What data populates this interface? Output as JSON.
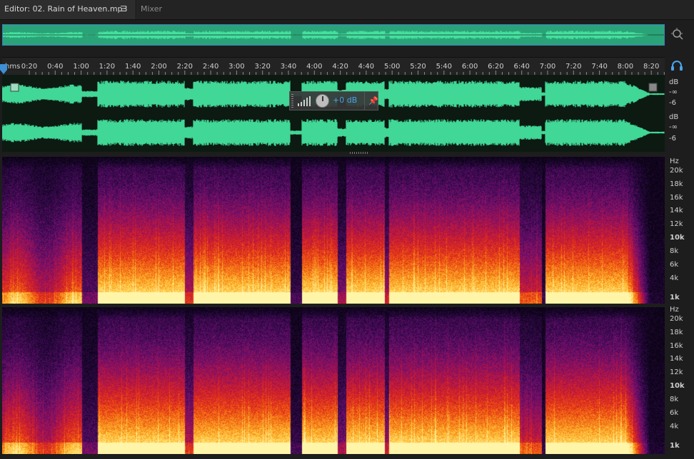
{
  "tabs": {
    "editor_label": "Editor: 02. Rain of Heaven.mp3",
    "menu_glyph": "☰",
    "mixer_label": "Mixer"
  },
  "ruler": {
    "unit_label": "hms",
    "labels": [
      "0:20",
      "0:40",
      "1:00",
      "1:20",
      "1:40",
      "2:00",
      "2:20",
      "2:40",
      "3:00",
      "3:20",
      "3:40",
      "4:00",
      "4:20",
      "4:40",
      "5:00",
      "5:20",
      "5:40",
      "6:00",
      "6:20",
      "6:40",
      "7:00",
      "7:20",
      "7:40",
      "8:00",
      "8:20"
    ]
  },
  "hud": {
    "gain_value": "+0 dB"
  },
  "db_scale": {
    "top_channel": [
      "dB",
      "-∞",
      "-6"
    ],
    "bottom_channel": [
      "dB",
      "-∞",
      "-6"
    ]
  },
  "hz_scale": {
    "top_channel": [
      "Hz",
      "20k",
      "18k",
      "16k",
      "14k",
      "12k",
      "10k",
      "8k",
      "6k",
      "4k",
      "1k"
    ],
    "bottom_channel": [
      "Hz",
      "20k",
      "18k",
      "16k",
      "14k",
      "12k",
      "10k",
      "8k",
      "6k",
      "4k",
      "1k"
    ]
  },
  "icons": {
    "zoom": "zoom-to-selection-icon",
    "headphones": "headphones-icon",
    "pin": "pin-icon",
    "levels": "level-bars-icon"
  },
  "colors": {
    "waveform": "#41d796",
    "waveform_bg": "#0c1a12",
    "selection_border": "#3b7fc0",
    "accent": "#4aa3e8"
  }
}
